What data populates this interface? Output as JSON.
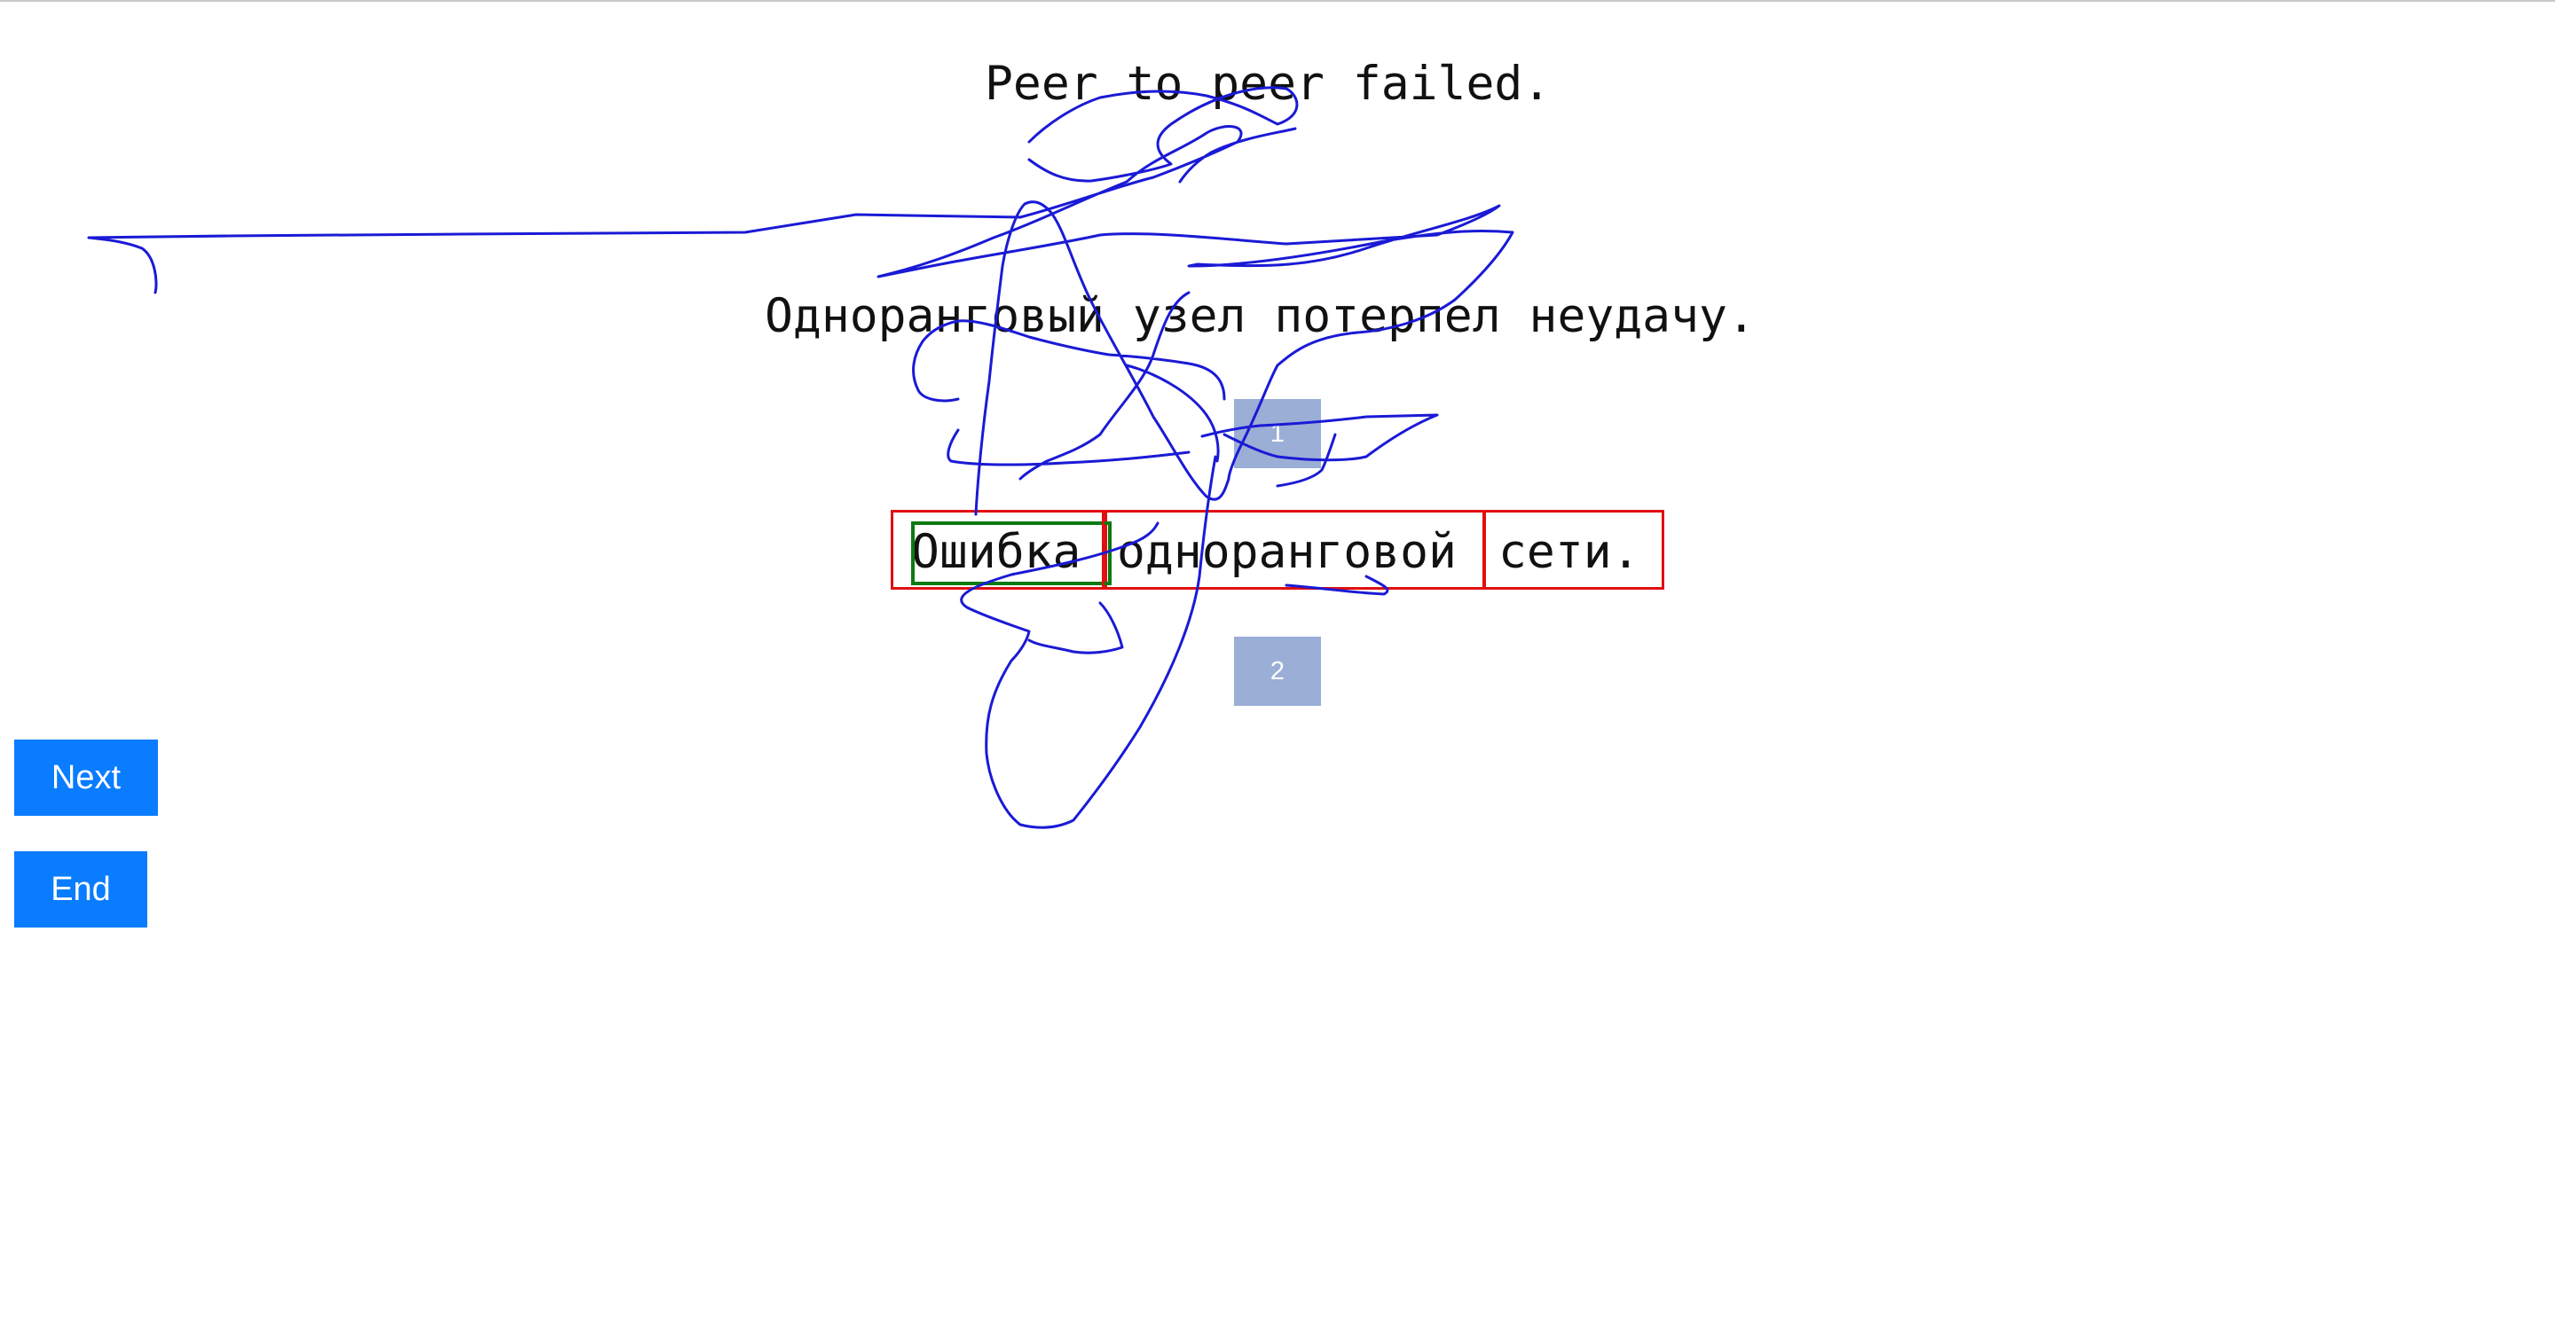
{
  "source": {
    "text": "Peer to peer failed."
  },
  "reference": {
    "text": "Одноранговый узел потерпел неудачу."
  },
  "badges": {
    "first": "1",
    "second": "2"
  },
  "tokens": [
    {
      "text": "Ошибка"
    },
    {
      "text": "одноранговой"
    },
    {
      "text": "сети."
    }
  ],
  "buttons": {
    "next_label": "Next",
    "end_label": "End"
  },
  "colors": {
    "button_bg": "#0a7cff",
    "badge_bg": "#9aaed6",
    "token_border": "#e01010",
    "highlight_border": "#0c7a12",
    "stroke": "#1a1ad6"
  },
  "annotation": {
    "type": "freehand-stroke"
  }
}
